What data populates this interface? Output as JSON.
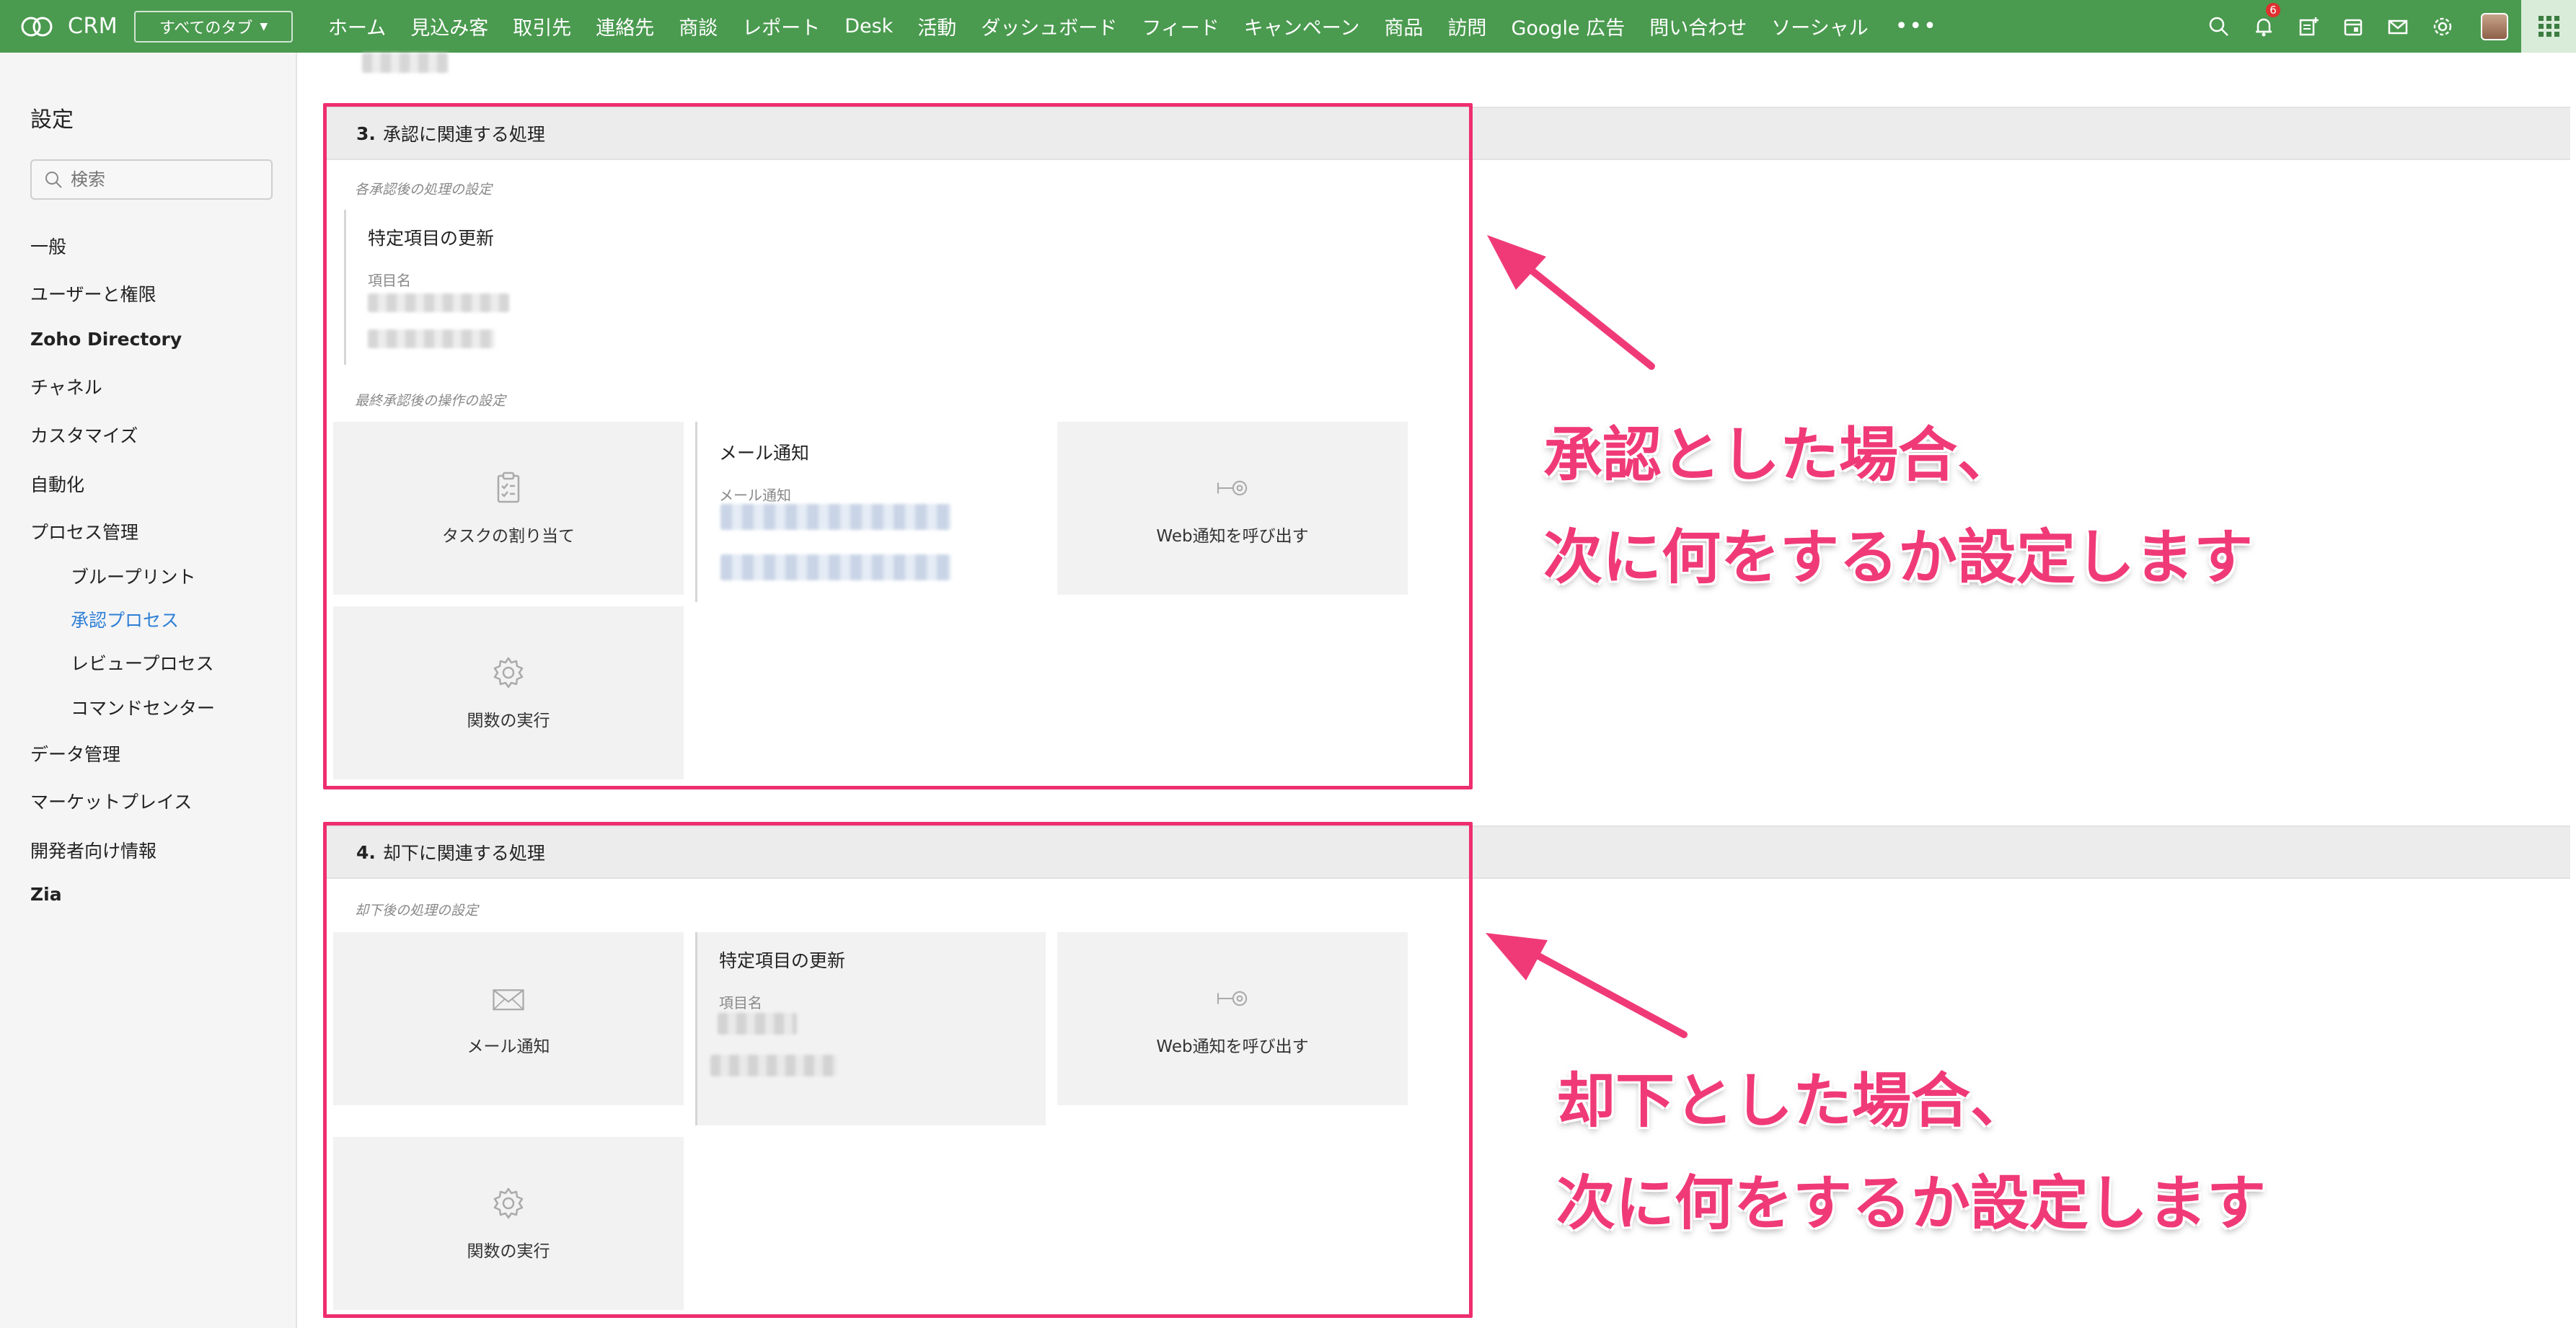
{
  "app": {
    "brand": "CRM",
    "all_tabs_label": "すべてのタブ",
    "nav": [
      "ホーム",
      "見込み客",
      "取引先",
      "連絡先",
      "商談",
      "レポート",
      "Desk",
      "活動",
      "ダッシュボード",
      "フィード",
      "キャンペーン",
      "商品",
      "訪問",
      "Google 広告",
      "問い合わせ",
      "ソーシャル"
    ],
    "nav_more": "•••",
    "notification_count": "6",
    "accent_color": "#4a9a4f"
  },
  "sidebar": {
    "title": "設定",
    "search_placeholder": "検索",
    "items": [
      "一般",
      "ユーザーと権限",
      "Zoho Directory",
      "チャネル",
      "カスタマイズ",
      "自動化",
      "プロセス管理"
    ],
    "process_subitems": [
      "ブループリント",
      "承認プロセス",
      "レビュープロセス",
      "コマンドセンター"
    ],
    "items_after": [
      "データ管理",
      "マーケットプレイス",
      "開発者向け情報",
      "Zia"
    ],
    "active_subitem": "承認プロセス",
    "active_color": "#2f7fd6"
  },
  "section3": {
    "number": "3.",
    "title": "承認に関連する処理",
    "after_each_caption": "各承認後の処理の設定",
    "field_update_title": "特定項目の更新",
    "field_name_label": "項目名",
    "final_caption": "最終承認後の操作の設定",
    "task_card": "タスクの割り当て",
    "email_title": "メール通知",
    "email_label": "メール通知",
    "webhook_card": "Web通知を呼び出す",
    "function_card": "関数の実行"
  },
  "section4": {
    "number": "4.",
    "title": "却下に関連する処理",
    "caption": "却下後の処理の設定",
    "email_card": "メール通知",
    "field_update_title": "特定項目の更新",
    "field_name_label": "項目名",
    "webhook_card": "Web通知を呼び出す",
    "function_card": "関数の実行"
  },
  "annotations": {
    "approve_line1": "承認とした場合、",
    "approve_line2": "次に何をするか設定します",
    "reject_line1": "却下とした場合、",
    "reject_line2": "次に何をするか設定します",
    "highlight_color": "#ee2e6f"
  }
}
